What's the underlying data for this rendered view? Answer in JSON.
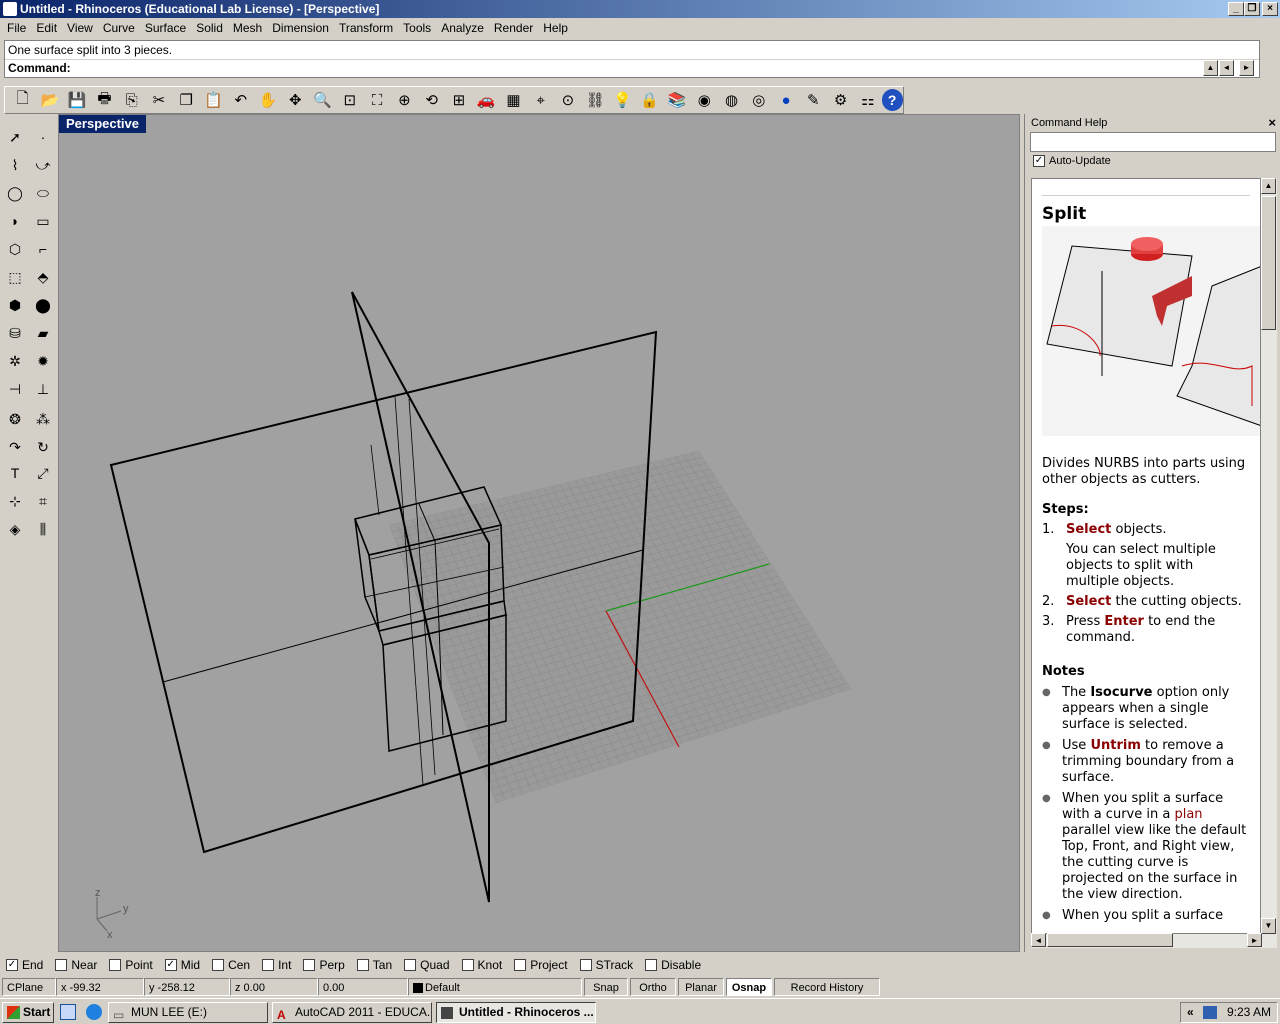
{
  "window": {
    "title": "Untitled - Rhinoceros (Educational Lab License) - [Perspective]"
  },
  "menu": [
    "File",
    "Edit",
    "View",
    "Curve",
    "Surface",
    "Solid",
    "Mesh",
    "Dimension",
    "Transform",
    "Tools",
    "Analyze",
    "Render",
    "Help"
  ],
  "command": {
    "history": "One surface split into 3 pieces.",
    "prompt": "Command:"
  },
  "viewport": {
    "label": "Perspective",
    "axis_x": "x",
    "axis_y": "y",
    "axis_z": "z"
  },
  "help": {
    "panel_title": "Command Help",
    "auto_update": "Auto-Update",
    "command": "Split",
    "description": "Divides NURBS into parts using other objects as cutters.",
    "steps_heading": "Steps:",
    "steps": [
      {
        "n": "1.",
        "action": "Select",
        "rest": "objects."
      },
      {
        "n": "2.",
        "action": "Select",
        "rest": "the cutting objects."
      },
      {
        "n": "3.",
        "pre": "Press",
        "action": "Enter",
        "rest": "to end the command."
      }
    ],
    "step1_note": "You can select multiple objects to split with multiple objects.",
    "notes_heading": "Notes",
    "notes": [
      {
        "pre": "The",
        "kw": "Isocurve",
        "rest": "option only appears when a single surface is selected."
      },
      {
        "pre": "Use",
        "kw": "Untrim",
        "rest": "to remove a trimming boundary from a surface."
      },
      {
        "pre": "When you split a surface with a curve in a",
        "link": "plan",
        "rest": "parallel view like the default Top, Front, and Right view, the cutting curve is projected on the surface in the view direction."
      },
      {
        "pre": "When you split a surface",
        "rest": ""
      }
    ]
  },
  "osnap": [
    {
      "label": "End",
      "checked": true
    },
    {
      "label": "Near",
      "checked": false
    },
    {
      "label": "Point",
      "checked": false
    },
    {
      "label": "Mid",
      "checked": true
    },
    {
      "label": "Cen",
      "checked": false
    },
    {
      "label": "Int",
      "checked": false
    },
    {
      "label": "Perp",
      "checked": false
    },
    {
      "label": "Tan",
      "checked": false
    },
    {
      "label": "Quad",
      "checked": false
    },
    {
      "label": "Knot",
      "checked": false
    },
    {
      "label": "Project",
      "checked": false
    },
    {
      "label": "STrack",
      "checked": false
    },
    {
      "label": "Disable",
      "checked": false
    }
  ],
  "status": {
    "cplane": "CPlane",
    "x": "x -99.32",
    "y": "y -258.12",
    "z": "z 0.00",
    "dist": "0.00",
    "layer": "Default",
    "snap": "Snap",
    "ortho": "Ortho",
    "planar": "Planar",
    "osnap": "Osnap",
    "record": "Record History"
  },
  "taskbar": {
    "start": "Start",
    "tasks": [
      "MUN LEE (E:)",
      "AutoCAD 2011 - EDUCA...",
      "Untitled - Rhinoceros ..."
    ],
    "clock": "9:23 AM"
  }
}
